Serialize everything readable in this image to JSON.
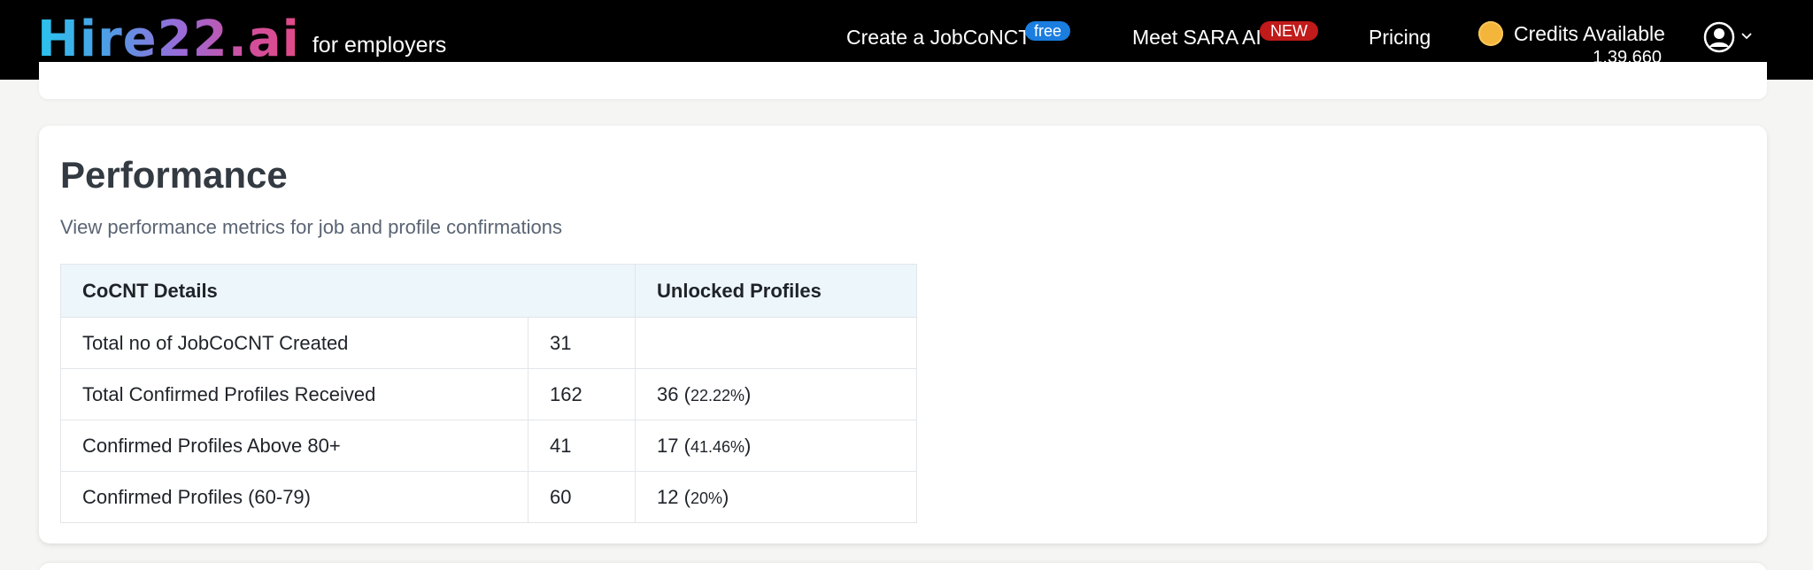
{
  "header": {
    "logo_text": "Hire22.ai",
    "logo_sub": "for employers",
    "nav": {
      "create_label": "Create a JobCoNCT",
      "create_badge": "free",
      "sara_label": "Meet SARA AI",
      "sara_badge": "NEW",
      "pricing_label": "Pricing"
    },
    "credits": {
      "label": "Credits Available",
      "value": "1,39,660",
      "icon": "coin-icon"
    },
    "user_icon": "user-circle-icon",
    "dropdown_icon": "chevron-down-icon"
  },
  "performance": {
    "title": "Performance",
    "subtitle": "View performance metrics for job and profile confirmations",
    "table": {
      "headers": [
        "CoCNT Details",
        "Unlocked Profiles"
      ],
      "rows": [
        {
          "label": "Total no of JobCoCNT Created",
          "count": "31",
          "unlocked": "",
          "pct": ""
        },
        {
          "label": "Total Confirmed Profiles Received",
          "count": "162",
          "unlocked": "36",
          "pct": "22.22%"
        },
        {
          "label": "Confirmed Profiles Above 80+",
          "count": "41",
          "unlocked": "17",
          "pct": "41.46%"
        },
        {
          "label": "Confirmed Profiles (60-79)",
          "count": "60",
          "unlocked": "12",
          "pct": "20%"
        }
      ]
    }
  },
  "colors": {
    "nav_bg": "#000000",
    "free_badge": "#1a7de0",
    "new_badge": "#c01a1a",
    "coin": "#f4b63a",
    "table_header_bg": "#edf6fa"
  }
}
